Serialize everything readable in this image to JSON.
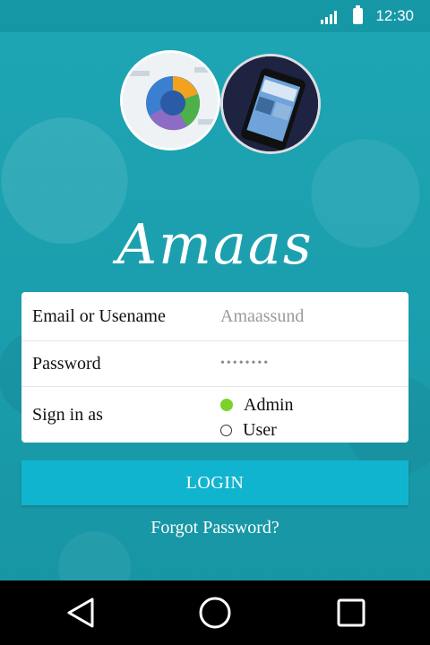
{
  "status_bar": {
    "time": "12:30",
    "icons": [
      "signal-icon",
      "battery-icon"
    ]
  },
  "app": {
    "name": "Amaas"
  },
  "colors": {
    "background": "#1b9fae",
    "button": "#11b4cf",
    "radio_selected": "#7dd22a",
    "card": "#ffffff"
  },
  "form": {
    "username_label": "Email or Usename",
    "username_value": "Amaassund",
    "password_label": "Password",
    "password_value": "••••••••",
    "signin_label": "Sign in as",
    "roles": [
      {
        "label": "Admin",
        "selected": true
      },
      {
        "label": "User",
        "selected": false
      }
    ]
  },
  "actions": {
    "login_label": "LOGIN",
    "forgot_label": "Forgot Password?"
  },
  "nav": {
    "icons": [
      "back-icon",
      "home-icon",
      "recent-apps-icon"
    ]
  }
}
